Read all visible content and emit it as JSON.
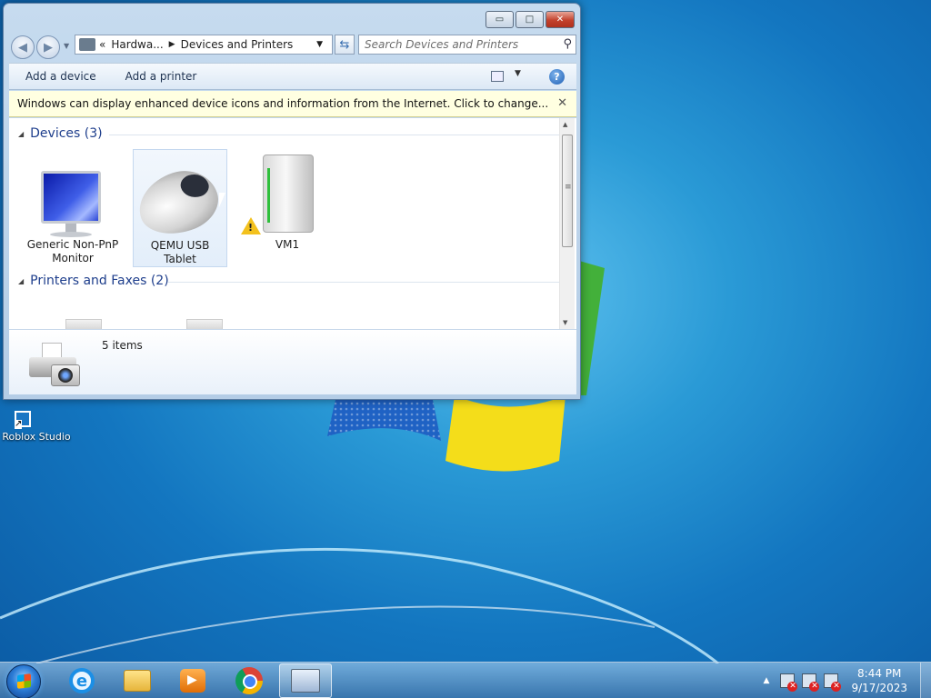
{
  "desktop": {
    "icons": [
      {
        "label": "Roblox Studio"
      }
    ]
  },
  "window": {
    "controls": {
      "minimize": "▭",
      "maximize": "□",
      "close": "✕"
    },
    "address": {
      "overflow": "«",
      "crumbs": [
        "Hardwa...",
        "Devices and Printers"
      ],
      "separator": "▶"
    },
    "search": {
      "placeholder": "Search Devices and Printers"
    },
    "toolbar": {
      "add_device": "Add a device",
      "add_printer": "Add a printer"
    },
    "infobar": {
      "text": "Windows can display enhanced device icons and information from the Internet. Click to change..."
    },
    "groups": {
      "devices": {
        "title": "Devices (3)"
      },
      "printers": {
        "title": "Printers and Faxes (2)"
      }
    },
    "devices": [
      {
        "name": "Generic Non-PnP Monitor",
        "icon": "monitor-icon"
      },
      {
        "name": "QEMU USB Tablet",
        "icon": "mouse-icon",
        "selected": true
      },
      {
        "name": "VM1",
        "icon": "computer-icon",
        "warning": true
      }
    ],
    "details": {
      "count": "5 items"
    }
  },
  "taskbar": {
    "apps": [
      "internet-explorer",
      "windows-explorer",
      "windows-media-player",
      "google-chrome",
      "devices-and-printers"
    ],
    "clock": {
      "time": "8:44 PM",
      "date": "9/17/2023"
    }
  },
  "colors": {
    "group_header": "#1e3e8c",
    "infobar_bg": "#ffffe1",
    "desktop": "#1376c0"
  }
}
